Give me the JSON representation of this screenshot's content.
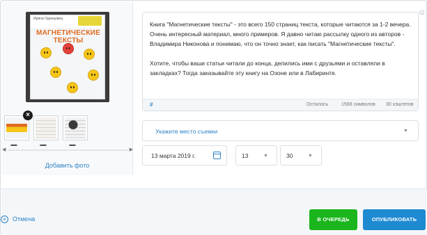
{
  "media": {
    "book": {
      "author": "Ирина Одинцовец",
      "title": "МАГНЕТИЧЕСКИЕ ТЕКСТЫ"
    },
    "add_photo_label": "Добавить фото",
    "thumb_dots": "▪▪▪▪▪▪",
    "remove_icon": "close-icon",
    "scroll_left": "◀",
    "scroll_right": "▶"
  },
  "post": {
    "text": "Книга \"Магнетические тексты\" - это всего 150 страниц текста, которые читаются за 1-2 вечера. Очень интересный материал, много примеров. Я давно читаю рассылку одного из авторов - Владимира Никонова и понимаю, что он точно знает, как писать \"Магнетические тексты\".\n\nХотите, чтобы ваши статьи читали до конца, делились ими с друзьями и оставляли в закладках? Тогда заказывайте эту книгу на Озоне или в Лабиринте.",
    "hashtag_label": "#",
    "remaining_label": "Осталось",
    "chars_left": "1568 символов",
    "hashtags_left": "30 хэштегов",
    "emoji_icon": "☺"
  },
  "location": {
    "placeholder": "Укажите место съемки",
    "caret": "▼"
  },
  "schedule": {
    "date": "13 марта 2019 г.",
    "hour": "13",
    "minute": "30",
    "caret": "▼"
  },
  "actions": {
    "cancel_label": "Отмена",
    "cancel_icon": "×",
    "queue_label": "В ОЧЕРЕДЬ",
    "publish_label": "ОПУБЛИКОВАТЬ"
  },
  "colors": {
    "accent": "#2f82c4",
    "queue": "#1bb51d",
    "publish": "#1e8ad2"
  }
}
